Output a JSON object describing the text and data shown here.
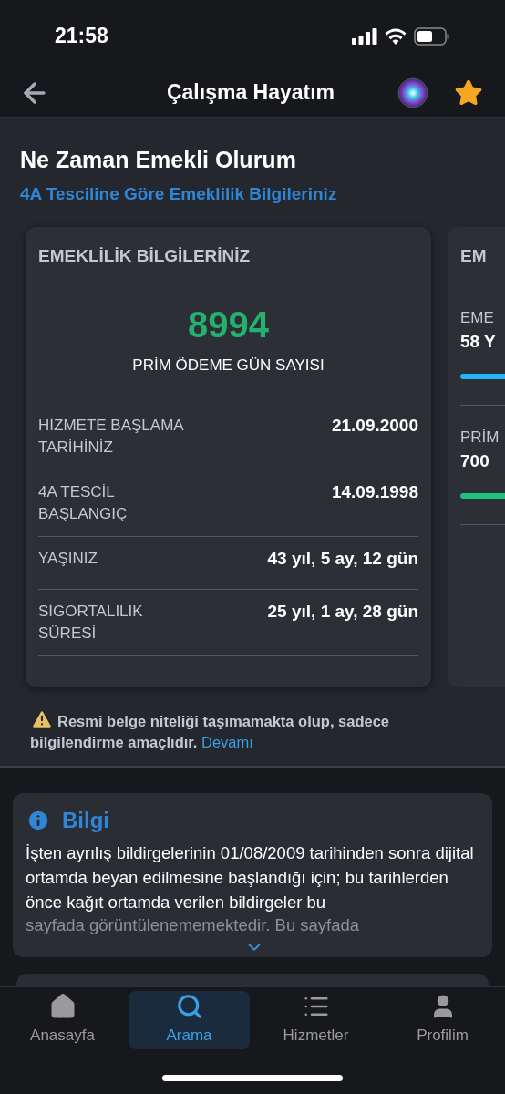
{
  "status_bar": {
    "time": "21:58"
  },
  "header": {
    "title": "Çalışma Hayatım",
    "favorite": true
  },
  "page": {
    "title": "Ne Zaman Emekli Olurum",
    "subtitle": "4A Tesciline Göre Emeklilik Bilgileriniz"
  },
  "card": {
    "title": "EMEKLİLİK BİLGİLERİNİZ",
    "big_number": "8994",
    "big_label": "PRİM ÖDEME GÜN SAYISI",
    "rows": [
      {
        "label": "HİZMETE BAŞLAMA TARİHİNİZ",
        "value": "21.09.2000"
      },
      {
        "label": "4A TESCİL BAŞLANGIÇ",
        "value": "14.09.1998"
      },
      {
        "label": "YAŞINIZ",
        "value": "43 yıl, 5 ay, 12 gün"
      },
      {
        "label": "SİGORTALILIK SÜRESİ",
        "value": "25 yıl, 1 ay, 28 gün"
      }
    ]
  },
  "card_2": {
    "title": "EM",
    "items": [
      {
        "label": "EME",
        "value": "58 Y",
        "color": "#1fb6f5"
      },
      {
        "label": "PRİM",
        "value": "700",
        "color": "#1fbf7c"
      }
    ]
  },
  "warning": {
    "text": "Resmi belge niteliği taşımamakta olup, sadece bilgilendirme amaçlıdır.",
    "link": "Devamı"
  },
  "info": {
    "title": "Bilgi",
    "text": "İşten ayrılış bildirgelerinin 01/08/2009 tarihinden sonra dijital ortamda beyan edilmesine başlandığı için; bu tarihlerden önce kağıt ortamda verilen bildirgeler bu",
    "faded_text": "sayfada görüntülenememektedir. Bu sayfada",
    "expanded": false
  },
  "tab_bar": [
    {
      "label": "Anasayfa",
      "selected": false
    },
    {
      "label": "Arama",
      "selected": true
    },
    {
      "label": "Hizmetler",
      "selected": false
    },
    {
      "label": "Profilim",
      "selected": false
    }
  ]
}
